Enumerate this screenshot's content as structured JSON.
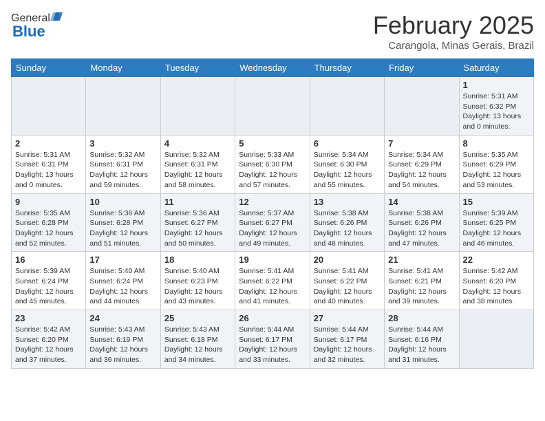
{
  "header": {
    "logo_general": "General",
    "logo_blue": "Blue",
    "title": "February 2025",
    "subtitle": "Carangola, Minas Gerais, Brazil"
  },
  "weekdays": [
    "Sunday",
    "Monday",
    "Tuesday",
    "Wednesday",
    "Thursday",
    "Friday",
    "Saturday"
  ],
  "weeks": [
    [
      {
        "day": "",
        "info": ""
      },
      {
        "day": "",
        "info": ""
      },
      {
        "day": "",
        "info": ""
      },
      {
        "day": "",
        "info": ""
      },
      {
        "day": "",
        "info": ""
      },
      {
        "day": "",
        "info": ""
      },
      {
        "day": "1",
        "info": "Sunrise: 5:31 AM\nSunset: 6:32 PM\nDaylight: 13 hours\nand 0 minutes."
      }
    ],
    [
      {
        "day": "2",
        "info": "Sunrise: 5:31 AM\nSunset: 6:31 PM\nDaylight: 13 hours\nand 0 minutes."
      },
      {
        "day": "3",
        "info": "Sunrise: 5:32 AM\nSunset: 6:31 PM\nDaylight: 12 hours\nand 59 minutes."
      },
      {
        "day": "4",
        "info": "Sunrise: 5:32 AM\nSunset: 6:31 PM\nDaylight: 12 hours\nand 58 minutes."
      },
      {
        "day": "5",
        "info": "Sunrise: 5:33 AM\nSunset: 6:30 PM\nDaylight: 12 hours\nand 57 minutes."
      },
      {
        "day": "6",
        "info": "Sunrise: 5:34 AM\nSunset: 6:30 PM\nDaylight: 12 hours\nand 55 minutes."
      },
      {
        "day": "7",
        "info": "Sunrise: 5:34 AM\nSunset: 6:29 PM\nDaylight: 12 hours\nand 54 minutes."
      },
      {
        "day": "8",
        "info": "Sunrise: 5:35 AM\nSunset: 6:29 PM\nDaylight: 12 hours\nand 53 minutes."
      }
    ],
    [
      {
        "day": "9",
        "info": "Sunrise: 5:35 AM\nSunset: 6:28 PM\nDaylight: 12 hours\nand 52 minutes."
      },
      {
        "day": "10",
        "info": "Sunrise: 5:36 AM\nSunset: 6:28 PM\nDaylight: 12 hours\nand 51 minutes."
      },
      {
        "day": "11",
        "info": "Sunrise: 5:36 AM\nSunset: 6:27 PM\nDaylight: 12 hours\nand 50 minutes."
      },
      {
        "day": "12",
        "info": "Sunrise: 5:37 AM\nSunset: 6:27 PM\nDaylight: 12 hours\nand 49 minutes."
      },
      {
        "day": "13",
        "info": "Sunrise: 5:38 AM\nSunset: 6:26 PM\nDaylight: 12 hours\nand 48 minutes."
      },
      {
        "day": "14",
        "info": "Sunrise: 5:38 AM\nSunset: 6:26 PM\nDaylight: 12 hours\nand 47 minutes."
      },
      {
        "day": "15",
        "info": "Sunrise: 5:39 AM\nSunset: 6:25 PM\nDaylight: 12 hours\nand 46 minutes."
      }
    ],
    [
      {
        "day": "16",
        "info": "Sunrise: 5:39 AM\nSunset: 6:24 PM\nDaylight: 12 hours\nand 45 minutes."
      },
      {
        "day": "17",
        "info": "Sunrise: 5:40 AM\nSunset: 6:24 PM\nDaylight: 12 hours\nand 44 minutes."
      },
      {
        "day": "18",
        "info": "Sunrise: 5:40 AM\nSunset: 6:23 PM\nDaylight: 12 hours\nand 43 minutes."
      },
      {
        "day": "19",
        "info": "Sunrise: 5:41 AM\nSunset: 6:22 PM\nDaylight: 12 hours\nand 41 minutes."
      },
      {
        "day": "20",
        "info": "Sunrise: 5:41 AM\nSunset: 6:22 PM\nDaylight: 12 hours\nand 40 minutes."
      },
      {
        "day": "21",
        "info": "Sunrise: 5:41 AM\nSunset: 6:21 PM\nDaylight: 12 hours\nand 39 minutes."
      },
      {
        "day": "22",
        "info": "Sunrise: 5:42 AM\nSunset: 6:20 PM\nDaylight: 12 hours\nand 38 minutes."
      }
    ],
    [
      {
        "day": "23",
        "info": "Sunrise: 5:42 AM\nSunset: 6:20 PM\nDaylight: 12 hours\nand 37 minutes."
      },
      {
        "day": "24",
        "info": "Sunrise: 5:43 AM\nSunset: 6:19 PM\nDaylight: 12 hours\nand 36 minutes."
      },
      {
        "day": "25",
        "info": "Sunrise: 5:43 AM\nSunset: 6:18 PM\nDaylight: 12 hours\nand 34 minutes."
      },
      {
        "day": "26",
        "info": "Sunrise: 5:44 AM\nSunset: 6:17 PM\nDaylight: 12 hours\nand 33 minutes."
      },
      {
        "day": "27",
        "info": "Sunrise: 5:44 AM\nSunset: 6:17 PM\nDaylight: 12 hours\nand 32 minutes."
      },
      {
        "day": "28",
        "info": "Sunrise: 5:44 AM\nSunset: 6:16 PM\nDaylight: 12 hours\nand 31 minutes."
      },
      {
        "day": "",
        "info": ""
      }
    ]
  ]
}
